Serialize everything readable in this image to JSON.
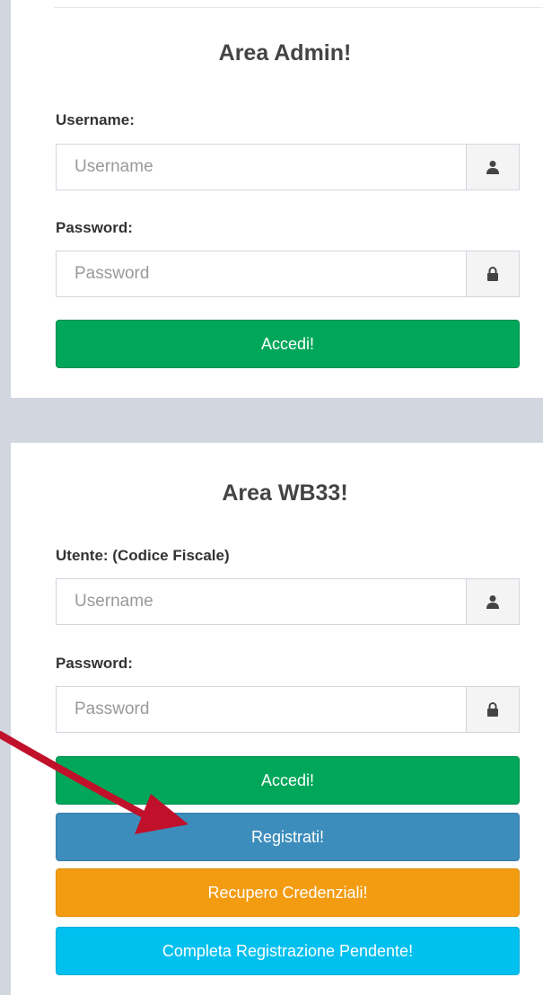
{
  "admin": {
    "title": "Area Admin!",
    "username_label": "Username:",
    "username_placeholder": "Username",
    "password_label": "Password:",
    "password_placeholder": "Password",
    "login_button": "Accedi!"
  },
  "wb33": {
    "title": "Area WB33!",
    "user_label": "Utente: (Codice Fiscale)",
    "username_placeholder": "Username",
    "password_label": "Password:",
    "password_placeholder": "Password",
    "login_button": "Accedi!",
    "register_button": "Registrati!",
    "recover_button": "Recupero Credenziali!",
    "complete_button": "Completa Registrazione Pendente!"
  },
  "icons": {
    "user": "user-icon",
    "lock": "lock-icon"
  },
  "colors": {
    "green": "#00a65a",
    "blue": "#3c8dbc",
    "orange": "#f39c12",
    "cyan": "#00c0ef",
    "arrow": "#c0102a"
  }
}
